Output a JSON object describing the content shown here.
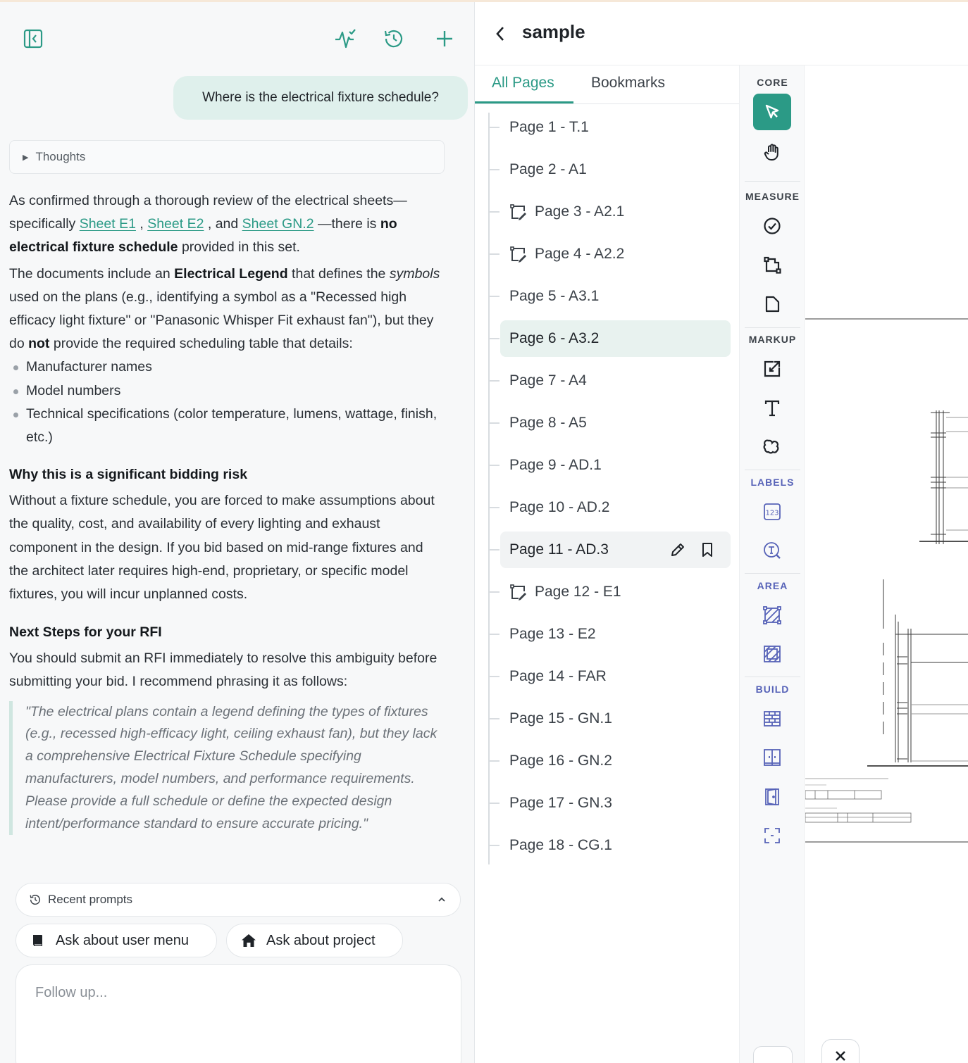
{
  "chat": {
    "user_message": "Where is the electrical fixture schedule?",
    "thoughts_label": "Thoughts",
    "answer": {
      "p1_a": "As confirmed through a thorough review of the electrical sheets—specifically ",
      "link_e1": "Sheet E1",
      "p1_b": " , ",
      "link_e2": "Sheet E2",
      "p1_c": " , and ",
      "link_gn2": "Sheet GN.2",
      "p1_d": " —there is ",
      "p1_bold_no": "no",
      "p1_e": " ",
      "p1_bold_schedule": "electrical fixture schedule",
      "p1_f": " provided in this set.",
      "p2_a": "The documents include an ",
      "p2_bold_legend": "Electrical Legend",
      "p2_b": " that defines the ",
      "p2_italic_symbols": "symbols",
      "p2_c": " used on the plans (e.g., identifying a symbol as a \"Recessed high efficacy light fixture\" or \"Panasonic Whisper Fit exhaust fan\"), but they do ",
      "p2_bold_not": "not",
      "p2_d": " provide the required scheduling table that details:",
      "bullets": [
        "Manufacturer names",
        "Model numbers",
        "Technical specifications (color temperature, lumens, wattage, finish, etc.)"
      ],
      "h_risk": "Why this is a significant bidding risk",
      "p_risk": "Without a fixture schedule, you are forced to make assumptions about the quality, cost, and availability of every lighting and exhaust component in the design. If you bid based on mid-range fixtures and the architect later requires high-end, proprietary, or specific model fixtures, you will incur unplanned costs.",
      "h_next": "Next Steps for your RFI",
      "p_next": "You should submit an RFI immediately to resolve this ambiguity before submitting your bid. I recommend phrasing it as follows:",
      "quote": "\"The electrical plans contain a legend defining the types of fixtures (e.g., recessed high-efficacy light, ceiling exhaust fan), but they lack a comprehensive Electrical Fixture Schedule specifying manufacturers, model numbers, and performance requirements. Please provide a full schedule or define the expected design intent/performance standard to ensure accurate pricing.\""
    },
    "recent_prompts_label": "Recent prompts",
    "suggestions": [
      "Ask about user menu",
      "Ask about project"
    ],
    "followup_placeholder": "Follow up..."
  },
  "document": {
    "title": "sample",
    "tabs": [
      "All Pages",
      "Bookmarks"
    ],
    "active_tab": "All Pages",
    "pages": [
      {
        "label": "Page 1 - T.1",
        "markup": false
      },
      {
        "label": "Page 2 - A1",
        "markup": false
      },
      {
        "label": "Page 3 - A2.1",
        "markup": true
      },
      {
        "label": "Page 4 - A2.2",
        "markup": true
      },
      {
        "label": "Page 5 - A3.1",
        "markup": false
      },
      {
        "label": "Page 6 - A3.2",
        "markup": false,
        "state": "selected"
      },
      {
        "label": "Page 7 - A4",
        "markup": false
      },
      {
        "label": "Page 8 - A5",
        "markup": false
      },
      {
        "label": "Page 9 - AD.1",
        "markup": false
      },
      {
        "label": "Page 10 - AD.2",
        "markup": false
      },
      {
        "label": "Page 11 - AD.3",
        "markup": false,
        "state": "hovered"
      },
      {
        "label": "Page 12 - E1",
        "markup": true
      },
      {
        "label": "Page 13 - E2",
        "markup": false
      },
      {
        "label": "Page 14 - FAR",
        "markup": false
      },
      {
        "label": "Page 15 - GN.1",
        "markup": false
      },
      {
        "label": "Page 16 - GN.2",
        "markup": false
      },
      {
        "label": "Page 17 - GN.3",
        "markup": false
      },
      {
        "label": "Page 18 - CG.1",
        "markup": false
      }
    ]
  },
  "toolbar": {
    "sections": [
      "CORE",
      "MEASURE",
      "MARKUP",
      "LABELS",
      "AREA",
      "BUILD"
    ],
    "label_tool_text": "123",
    "colors": {
      "accent": "#2b9a86",
      "blue_sections": "#5763b8"
    }
  },
  "icons": {
    "header": [
      "collapse-sidebar-icon",
      "activity-icon",
      "history-icon",
      "plus-icon"
    ],
    "core": [
      "select-arrow-icon",
      "pan-hand-icon"
    ],
    "measure": [
      "check-circle-icon",
      "polyline-icon",
      "shape-icon"
    ],
    "markup": [
      "external-edit-icon",
      "text-icon",
      "cloud-icon"
    ],
    "labels": [
      "number-label-icon",
      "text-search-icon"
    ],
    "area": [
      "area-hatch-icon",
      "area-grid-icon"
    ],
    "build": [
      "wall-icon",
      "window-icon",
      "door-icon",
      "bracket-icon"
    ]
  }
}
